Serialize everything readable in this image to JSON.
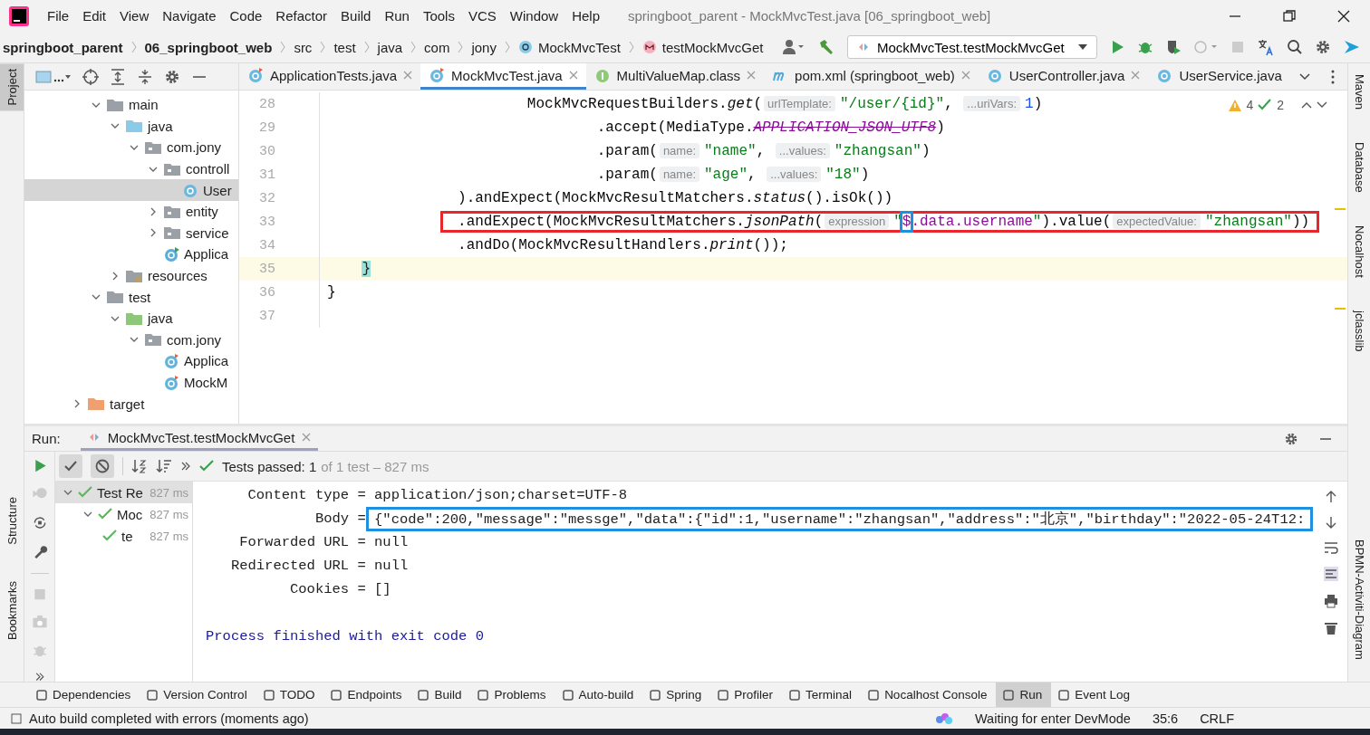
{
  "window": {
    "title": "springboot_parent - MockMvcTest.java [06_springboot_web]"
  },
  "menu": [
    "File",
    "Edit",
    "View",
    "Navigate",
    "Code",
    "Refactor",
    "Build",
    "Run",
    "Tools",
    "VCS",
    "Window",
    "Help"
  ],
  "breadcrumbs": [
    {
      "label": "springboot_parent",
      "kind": "project"
    },
    {
      "label": "06_springboot_web",
      "kind": "project"
    },
    {
      "label": "src",
      "kind": "dir"
    },
    {
      "label": "test",
      "kind": "dir"
    },
    {
      "label": "java",
      "kind": "dir"
    },
    {
      "label": "com",
      "kind": "dir"
    },
    {
      "label": "jony",
      "kind": "dir"
    },
    {
      "label": "MockMvcTest",
      "kind": "class"
    },
    {
      "label": "testMockMvcGet",
      "kind": "method"
    }
  ],
  "run_config": {
    "label": "MockMvcTest.testMockMvcGet"
  },
  "left_stripe": {
    "top": [
      {
        "label": "Project",
        "selected": true
      }
    ],
    "bottom": [
      {
        "label": "Structure",
        "selected": false
      },
      {
        "label": "Bookmarks",
        "selected": false
      }
    ]
  },
  "right_stripe": {
    "top": [
      {
        "label": "Maven"
      },
      {
        "label": "Database"
      },
      {
        "label": "Nocalhost"
      },
      {
        "label": "jclasslib"
      }
    ],
    "bottom": [
      {
        "label": "BPMN-Activiti-Diagram"
      }
    ]
  },
  "project_tree": [
    {
      "children": [
        {
          "label": "main",
          "kind": "folder",
          "expanded": true,
          "selected": false,
          "children": [
            {
              "label": "java",
              "kind": "source-folder",
              "expanded": true,
              "selected": false,
              "children": [
                {
                  "label": "com.jony",
                  "kind": "package",
                  "expanded": true,
                  "selected": false,
                  "children": [
                    {
                      "label": "controll",
                      "kind": "package",
                      "expanded": true,
                      "selected": false,
                      "children": [
                        {
                          "label": "User",
                          "kind": "class",
                          "selected": true
                        }
                      ]
                    },
                    {
                      "label": "entity",
                      "kind": "package",
                      "expanded": false,
                      "selected": false
                    },
                    {
                      "label": "service",
                      "kind": "package",
                      "expanded": false,
                      "selected": false
                    },
                    {
                      "label": "Applica",
                      "kind": "app-class",
                      "selected": false
                    }
                  ]
                }
              ]
            },
            {
              "label": "resources",
              "kind": "resources",
              "expanded": false,
              "selected": false
            }
          ]
        },
        {
          "label": "test",
          "kind": "folder",
          "expanded": true,
          "selected": false,
          "children": [
            {
              "label": "java",
              "kind": "test-folder",
              "expanded": true,
              "selected": false,
              "children": [
                {
                  "label": "com.jony",
                  "kind": "package",
                  "expanded": true,
                  "selected": false,
                  "children": [
                    {
                      "label": "Applica",
                      "kind": "test-class",
                      "selected": false
                    },
                    {
                      "label": "MockM",
                      "kind": "test-class",
                      "selected": false
                    }
                  ]
                }
              ]
            }
          ]
        }
      ]
    },
    {
      "label": "target",
      "kind": "excluded",
      "expanded": false,
      "selected": false
    }
  ],
  "editor_tabs": [
    {
      "label": "ApplicationTests.java",
      "kind": "test-class",
      "selected": false,
      "closable": true
    },
    {
      "label": "MockMvcTest.java",
      "kind": "test-class",
      "selected": true,
      "closable": true
    },
    {
      "label": "MultiValueMap.class",
      "kind": "interface",
      "selected": false,
      "closable": true
    },
    {
      "label": "pom.xml (springboot_web)",
      "kind": "maven",
      "selected": false,
      "closable": true
    },
    {
      "label": "UserController.java",
      "kind": "class",
      "selected": false,
      "closable": true
    },
    {
      "label": "UserService.java",
      "kind": "class",
      "selected": false,
      "closable": false
    }
  ],
  "inspections": {
    "warnings": "4",
    "checks": "2"
  },
  "code_lines": [
    {
      "number": "28",
      "current": false,
      "boxed": false,
      "tokens": [
        {
          "text": "                       MockMvcRequestBuilders.",
          "kind": "plain"
        },
        {
          "text": "get",
          "kind": "method"
        },
        {
          "text": "(",
          "kind": "plain"
        },
        {
          "text": "urlTemplate:",
          "kind": "hint"
        },
        {
          "text": "\"/user/{id}\"",
          "kind": "string"
        },
        {
          "text": ", ",
          "kind": "plain"
        },
        {
          "text": "...uriVars:",
          "kind": "hint"
        },
        {
          "text": "1",
          "kind": "number"
        },
        {
          "text": ")",
          "kind": "plain"
        }
      ]
    },
    {
      "number": "29",
      "current": false,
      "boxed": false,
      "tokens": [
        {
          "text": "                               .accept(MediaType.",
          "kind": "plain"
        },
        {
          "text": "APPLICATION_JSON_UTF8",
          "kind": "deprecated"
        },
        {
          "text": ")",
          "kind": "plain"
        }
      ]
    },
    {
      "number": "30",
      "current": false,
      "boxed": false,
      "tokens": [
        {
          "text": "                               .param(",
          "kind": "plain"
        },
        {
          "text": "name:",
          "kind": "hint"
        },
        {
          "text": "\"name\"",
          "kind": "string"
        },
        {
          "text": ", ",
          "kind": "plain"
        },
        {
          "text": "...values:",
          "kind": "hint"
        },
        {
          "text": "\"zhangsan\"",
          "kind": "string"
        },
        {
          "text": ")",
          "kind": "plain"
        }
      ]
    },
    {
      "number": "31",
      "current": false,
      "boxed": false,
      "tokens": [
        {
          "text": "                               .param(",
          "kind": "plain"
        },
        {
          "text": "name:",
          "kind": "hint"
        },
        {
          "text": "\"age\"",
          "kind": "string"
        },
        {
          "text": ", ",
          "kind": "plain"
        },
        {
          "text": "...values:",
          "kind": "hint"
        },
        {
          "text": "\"18\"",
          "kind": "string"
        },
        {
          "text": ")",
          "kind": "plain"
        }
      ]
    },
    {
      "number": "32",
      "current": false,
      "boxed": false,
      "tokens": [
        {
          "text": "               ).andExpect(MockMvcResultMatchers.",
          "kind": "plain"
        },
        {
          "text": "status",
          "kind": "method"
        },
        {
          "text": "().isOk())",
          "kind": "plain"
        }
      ]
    },
    {
      "number": "33",
      "current": false,
      "boxed": true,
      "tokens": [
        {
          "text": "               .andExpect(MockMvcResultMatchers.",
          "kind": "plain"
        },
        {
          "text": "jsonPath",
          "kind": "method"
        },
        {
          "text": "(",
          "kind": "plain"
        },
        {
          "text": "expression",
          "kind": "hint"
        },
        {
          "text": "\"",
          "kind": "string"
        },
        {
          "text": "$",
          "kind": "path",
          "boxed": true
        },
        {
          "text": ".data.username",
          "kind": "path",
          "boxed": false
        },
        {
          "text": "\"",
          "kind": "string"
        },
        {
          "text": ").value(",
          "kind": "plain"
        },
        {
          "text": "expectedValue:",
          "kind": "hint"
        },
        {
          "text": "\"zhangsan\"",
          "kind": "string"
        },
        {
          "text": "))",
          "kind": "plain"
        }
      ]
    },
    {
      "number": "34",
      "current": false,
      "boxed": false,
      "tokens": [
        {
          "text": "               .andDo(MockMvcResultHandlers.",
          "kind": "plain"
        },
        {
          "text": "print",
          "kind": "method"
        },
        {
          "text": "());",
          "kind": "plain"
        }
      ]
    },
    {
      "number": "35",
      "current": true,
      "boxed": false,
      "tokens": [
        {
          "text": "    }",
          "kind": "brace"
        }
      ]
    },
    {
      "number": "36",
      "current": false,
      "boxed": false,
      "tokens": [
        {
          "text": "}",
          "kind": "plain"
        }
      ]
    },
    {
      "number": "37",
      "current": false
    }
  ],
  "run_panel": {
    "title": "Run:",
    "tab": "MockMvcTest.testMockMvcGet",
    "status": "Tests passed: 1",
    "status_detail": "of 1 test – 827 ms",
    "tests": [
      {
        "label": "Test Re",
        "time": "827 ms",
        "passed": true,
        "expanded": true,
        "selected": true,
        "children": [
          {
            "label": "Moc",
            "time": "827 ms",
            "passed": true,
            "expanded": true,
            "selected": false,
            "children": [
              {
                "label": "te",
                "time": "827 ms",
                "passed": true,
                "selected": false
              }
            ]
          }
        ]
      }
    ],
    "console": [
      {
        "kind": "output",
        "text": "     Content type = application/json;charset=UTF-8"
      },
      {
        "kind": "output",
        "text": "             Body = ",
        "value": "{\"code\":200,\"message\":\"messge\",\"data\":{\"id\":1,\"username\":\"zhangsan\",\"address\":\"北京\",\"birthday\":\"2022-05-24T12:",
        "boxed": true
      },
      {
        "kind": "output",
        "text": "    Forwarded URL = null"
      },
      {
        "kind": "output",
        "text": "   Redirected URL = null"
      },
      {
        "kind": "output",
        "text": "          Cookies = []"
      },
      {
        "kind": "system",
        "text": "Process finished with exit code 0"
      }
    ]
  },
  "tool_windows": [
    {
      "label": "Dependencies",
      "selected": false
    },
    {
      "label": "Version Control",
      "selected": false
    },
    {
      "label": "TODO",
      "selected": false
    },
    {
      "label": "Endpoints",
      "selected": false
    },
    {
      "label": "Build",
      "selected": false
    },
    {
      "label": "Problems",
      "selected": false
    },
    {
      "label": "Auto-build",
      "selected": false
    },
    {
      "label": "Spring",
      "selected": false
    },
    {
      "label": "Profiler",
      "selected": false
    },
    {
      "label": "Terminal",
      "selected": false
    },
    {
      "label": "Nocalhost Console",
      "selected": false
    },
    {
      "label": "Run",
      "selected": true
    },
    {
      "label": "Event Log",
      "selected": false
    }
  ],
  "status_bar": {
    "message": "Auto build completed with errors (moments ago)",
    "devmode": "Waiting for enter DevMode",
    "position": "35:6",
    "line_separator": "CRLF"
  }
}
